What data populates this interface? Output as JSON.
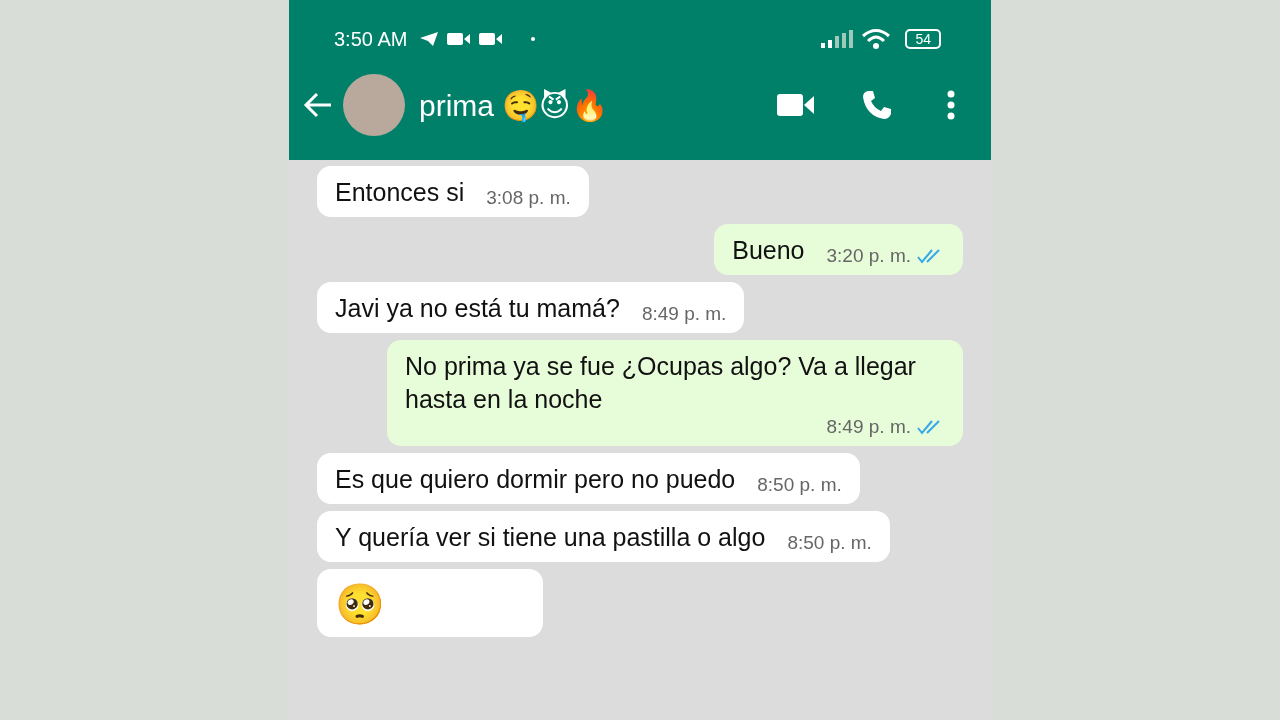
{
  "status_bar": {
    "time": "3:50 AM",
    "battery": "54"
  },
  "header": {
    "contact_name": "prima 🤤😈🔥"
  },
  "messages": [
    {
      "kind": "in",
      "text": "Entonces si",
      "time": "3:08 p. m."
    },
    {
      "kind": "out",
      "text": "Bueno",
      "time": "3:20 p. m.",
      "read": true
    },
    {
      "kind": "in",
      "text": "Javi ya no está tu mamá?",
      "time": "8:49 p. m."
    },
    {
      "kind": "out",
      "text": "No prima ya se fue ¿Ocupas algo? Va a llegar hasta en la noche",
      "time": "8:49 p. m.",
      "read": true
    },
    {
      "kind": "in",
      "text": "Es que quiero dormir pero no puedo",
      "time": "8:50 p. m."
    },
    {
      "kind": "in",
      "text": "Y quería ver si tiene una pastilla o algo",
      "time": "8:50 p. m."
    },
    {
      "kind": "in",
      "text": "🥺"
    }
  ]
}
